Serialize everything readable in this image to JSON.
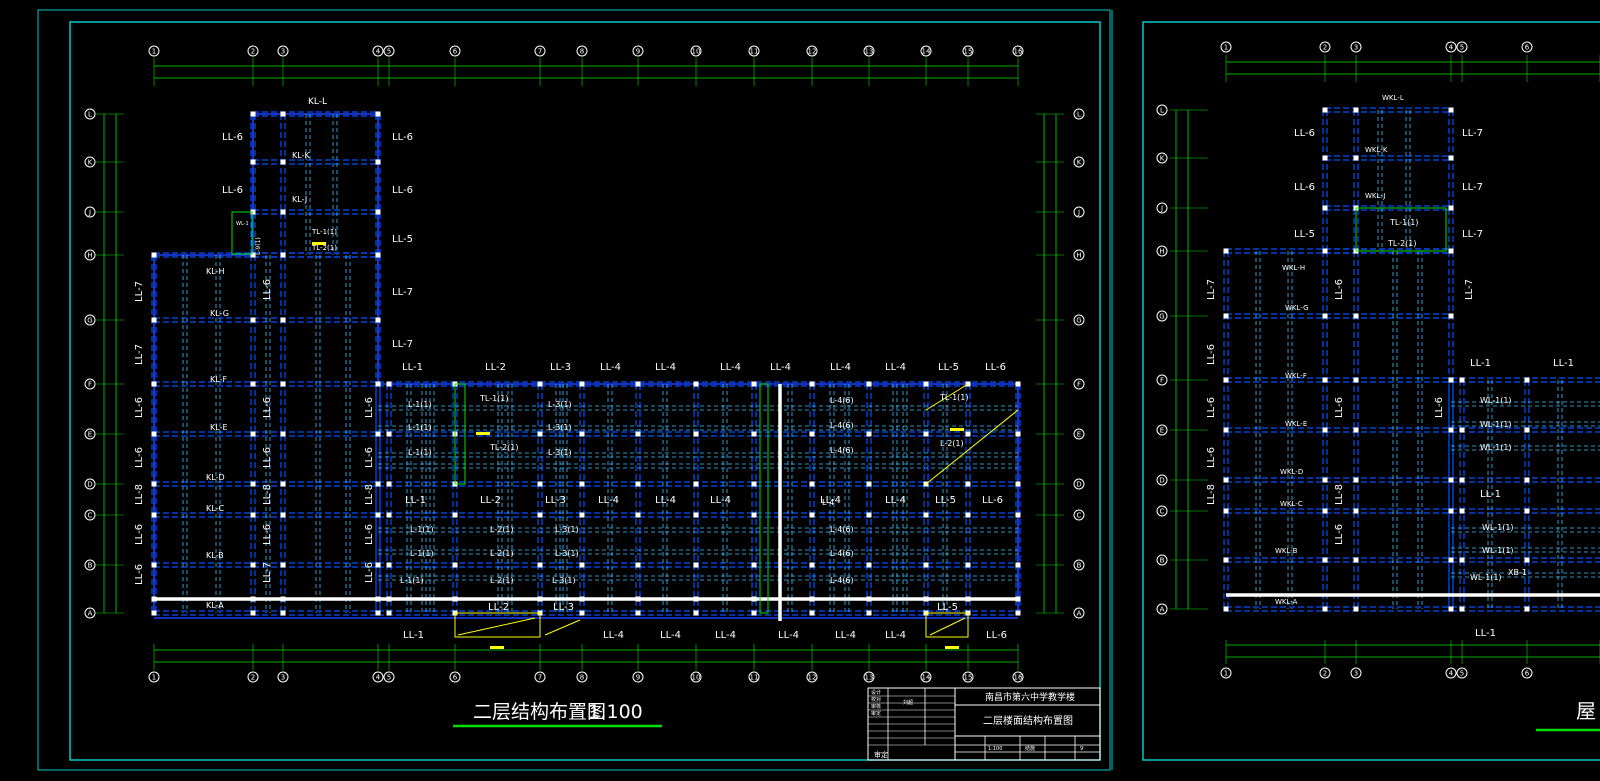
{
  "left_sheet": {
    "title": "二层结构布置图",
    "scale": "1:100",
    "title_block": {
      "school": "南昌市第六中学教学楼",
      "drawing_name": "二层楼面结构布置图",
      "row_labels": [
        "设计",
        "校对",
        "审核",
        "审定"
      ],
      "reviewer": "刘超",
      "bottom_cells": [
        "1:100",
        "结施",
        "9"
      ],
      "footer": "审定"
    },
    "axis_numbers": [
      "1",
      "2",
      "3",
      "4",
      "5",
      "6",
      "7",
      "8",
      "9",
      "10",
      "11",
      "12",
      "13",
      "14",
      "15",
      "16"
    ],
    "axis_letters": [
      "L",
      "K",
      "J",
      "H",
      "G",
      "F",
      "E",
      "D",
      "C",
      "B",
      "A"
    ],
    "west_block_labels": [
      {
        "text": "KL-L",
        "kind": "kl"
      },
      {
        "text": "KL-K",
        "kind": "kl"
      },
      {
        "text": "KL-J",
        "kind": "kl"
      },
      {
        "text": "KL-H",
        "kind": "kl"
      },
      {
        "text": "KL-G",
        "kind": "kl"
      },
      {
        "text": "KL-F",
        "kind": "kl"
      },
      {
        "text": "KL-E",
        "kind": "kl"
      },
      {
        "text": "KL-D",
        "kind": "kl"
      },
      {
        "text": "KL-C",
        "kind": "kl"
      },
      {
        "text": "KL-B",
        "kind": "kl"
      },
      {
        "text": "KL-A",
        "kind": "kl"
      }
    ],
    "side_ll_labels": [
      {
        "text": "LL-6"
      },
      {
        "text": "LL-6"
      },
      {
        "text": "LL-5"
      },
      {
        "text": "LL-7"
      },
      {
        "text": "LL-7"
      },
      {
        "text": "LL-7"
      },
      {
        "text": "LL-7"
      },
      {
        "text": "LL-6"
      },
      {
        "text": "LL-6"
      },
      {
        "text": "LL-8"
      },
      {
        "text": "LL-6"
      },
      {
        "text": "LL-6"
      },
      {
        "text": "LL-6"
      },
      {
        "text": "LL-6"
      },
      {
        "text": "LL-8"
      },
      {
        "text": "LL-6"
      },
      {
        "text": "LL-6"
      },
      {
        "text": "LL-7"
      },
      {
        "text": "LL-6"
      },
      {
        "text": "LL-6"
      },
      {
        "text": "LL-8"
      },
      {
        "text": "LL-6"
      },
      {
        "text": "LL-6"
      }
    ],
    "top_ll_labels": [
      "LL-1",
      "LL-2",
      "LL-3",
      "LL-4",
      "LL-4",
      "LL-4",
      "LL-4",
      "LL-4",
      "LL-4",
      "LL-5",
      "LL-6"
    ],
    "mid_ll_labels": [
      "LL-1",
      "LL-2",
      "LL-3",
      "LL-4",
      "LL-4",
      "LL-4",
      "LL-4",
      "LL-4",
      "LL-5",
      "LL-6"
    ],
    "bottom_ll_labels": [
      "LL-1",
      "LL-2",
      "LL-3",
      "LL-4",
      "LL-4",
      "LL-4",
      "LL-4",
      "LL-4",
      "LL-4",
      "LL-5",
      "LL-6"
    ],
    "beam_labels": [
      "L-1(1)",
      "L-1(1)",
      "L-1(1)",
      "TL-1(1)",
      "TL-2(1)",
      "L-3(1)",
      "L-3(1)",
      "L-3(1)",
      "L-4(6)",
      "L-4(6)",
      "L-4(6)",
      "TL-1(1)",
      "L-2(1)",
      "L-1(1)",
      "L-1(1)",
      "L-1(1)",
      "L-2(1)",
      "L-2(1)",
      "L-2(1)",
      "L-3(1)",
      "L-3(1)",
      "L-3(1)",
      "L-4(6)",
      "L-4(6)",
      "L-4(6)",
      "L-4"
    ],
    "small_labels": [
      "TL-1(1)",
      "TL-2(1)",
      "WL-1",
      "L-9(1)"
    ]
  },
  "right_sheet": {
    "axis_numbers": [
      "1",
      "2",
      "3",
      "4",
      "5",
      "6"
    ],
    "axis_letters": [
      "L",
      "K",
      "J",
      "H",
      "G",
      "F",
      "E",
      "D",
      "C",
      "B",
      "A"
    ],
    "ll_labels": [
      "LL-6",
      "LL-6",
      "LL-5",
      "LL-7",
      "LL-7",
      "LL-7",
      "LL-7",
      "LL-6",
      "LL-6",
      "LL-6",
      "LL-8",
      "LL-8",
      "LL-6",
      "LL-6",
      "LL-6",
      "LL-6",
      "LL-7",
      "LL-1",
      "LL-1",
      "LL-1",
      "LL-1"
    ],
    "wkl_labels": [
      "WKL-L",
      "WKL-K",
      "WKL-J",
      "WKL-H",
      "WKL-G",
      "WKL-F",
      "WKL-E",
      "WKL-D",
      "WKL-C",
      "WKL-B",
      "WKL-A"
    ],
    "wl_labels": [
      "WL-1(1)",
      "WL-1(1)",
      "WL-1(1)",
      "WL-1(1)",
      "WL-1(1)",
      "WL-1(1)",
      "XB-1",
      "TL-1(1)",
      "TL-2(1)"
    ],
    "title_partial": "屋"
  }
}
